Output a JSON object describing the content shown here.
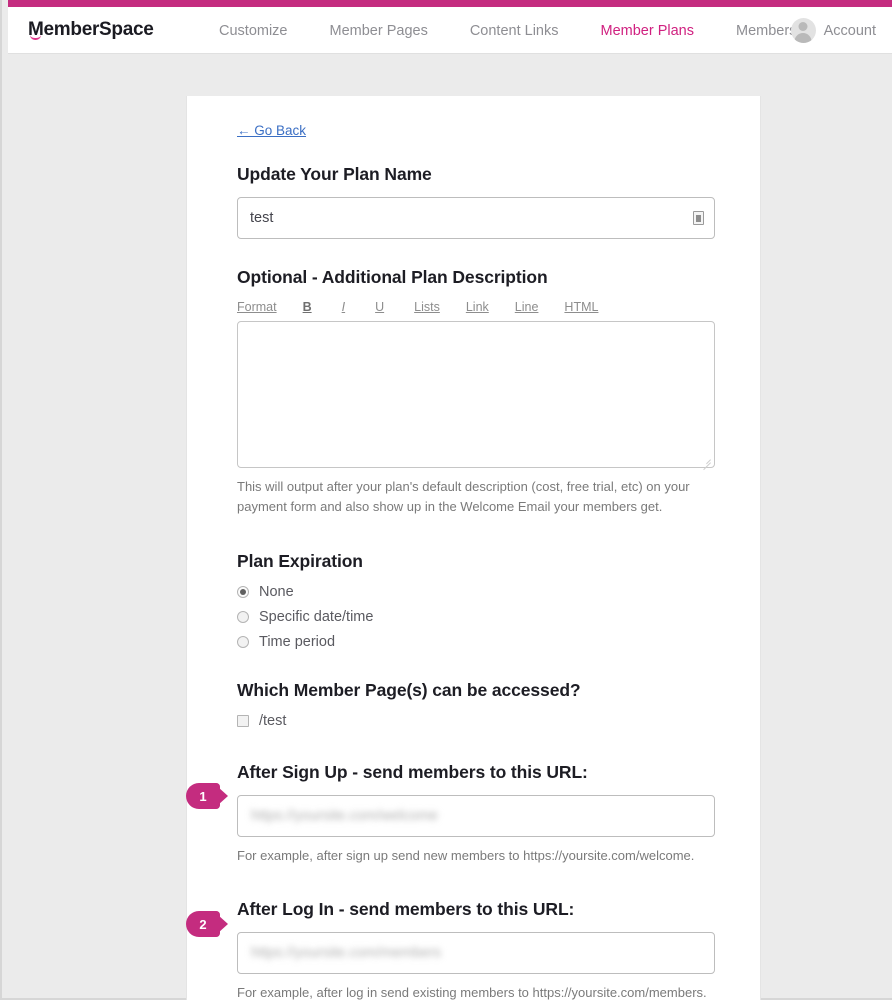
{
  "brand": {
    "accent_pink": "#c42c7f",
    "logo_text": "MemberSpace",
    "logo_prefix": "M",
    "logo_suffix": "emberSpace"
  },
  "header": {
    "nav": [
      {
        "label": "Customize",
        "active": false
      },
      {
        "label": "Member Pages",
        "active": false
      },
      {
        "label": "Content Links",
        "active": false
      },
      {
        "label": "Member Plans",
        "active": true
      },
      {
        "label": "Members",
        "active": false
      }
    ],
    "account_label": "Account"
  },
  "main": {
    "go_back_label": "← Go Back",
    "plan_name": {
      "title": "Update Your Plan Name",
      "value": "test",
      "icon": "form-autofill-icon"
    },
    "description": {
      "title": "Optional - Additional Plan Description",
      "toolbar": [
        "Format",
        "B",
        "I",
        "U",
        "Lists",
        "Link",
        "Line",
        "HTML"
      ],
      "value": "",
      "help": "This will output after your plan's default description (cost, free trial, etc) on your payment form and also show up in the Welcome Email your members get."
    },
    "expiration": {
      "title": "Plan Expiration",
      "options": [
        {
          "label": "None",
          "selected": true
        },
        {
          "label": "Specific date/time",
          "selected": false
        },
        {
          "label": "Time period",
          "selected": false
        }
      ]
    },
    "member_pages": {
      "title": "Which Member Page(s) can be accessed?",
      "options": [
        {
          "label": "/test",
          "checked": false
        }
      ]
    },
    "after_sign_up": {
      "title": "After Sign Up - send members to this URL:",
      "value": "https://yoursite.com/welcome",
      "help": "For example, after sign up send new members to https://yoursite.com/welcome.",
      "callout": "1"
    },
    "after_log_in": {
      "title": "After Log In - send members to this URL:",
      "value": "https://yoursite.com/members",
      "help": "For example, after log in send existing members to https://yoursite.com/members.",
      "callout": "2"
    }
  }
}
